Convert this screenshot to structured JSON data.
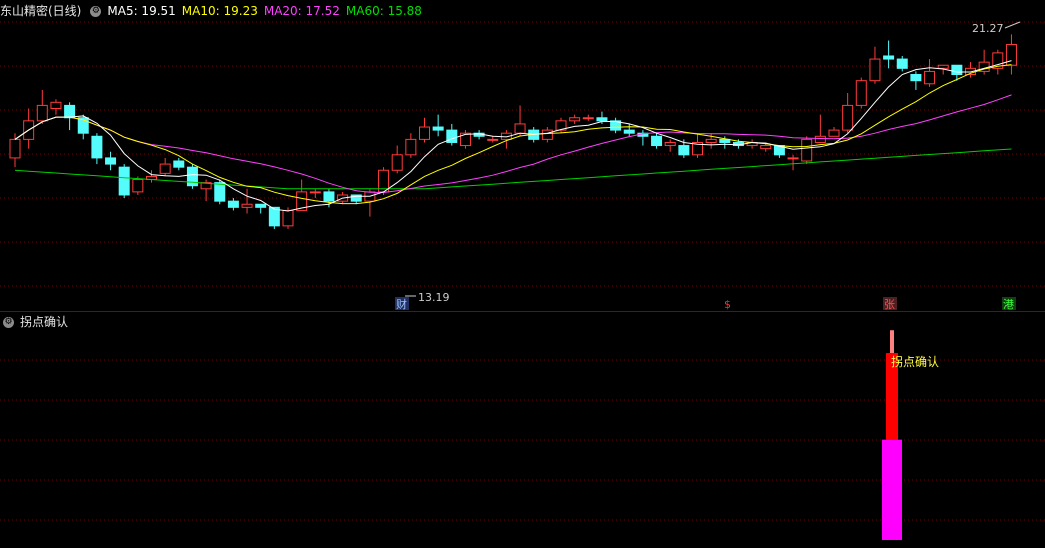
{
  "main": {
    "title": "东山精密(日线)",
    "ma5": "MA5: 19.51",
    "ma10": "MA10: 19.23",
    "ma20": "MA20: 17.52",
    "ma60": "MA60: 15.88",
    "high_label": "21.27",
    "low_label": "13.19",
    "markers": [
      {
        "label": "财",
        "color": "#a0c0ff"
      },
      {
        "label": "$",
        "color": "#ff3030"
      },
      {
        "label": "张",
        "color": "#ff5050"
      },
      {
        "label": "港",
        "color": "#40ff40"
      }
    ]
  },
  "sub": {
    "title": "拐点确认",
    "signal_label": "拐点确认"
  },
  "colors": {
    "up": "#ff3b3b",
    "down": "#54fcfc",
    "ma5": "#ffffff",
    "ma10": "#ffff00",
    "ma20": "#ff40ff",
    "ma60": "#00d000",
    "grid": "#7a0000"
  },
  "chart_data": {
    "type": "candlestick",
    "candles": [
      [
        17.6,
        18.2,
        17.3,
        18.4
      ],
      [
        18.2,
        18.8,
        17.9,
        19.2
      ],
      [
        18.8,
        19.3,
        18.7,
        19.8
      ],
      [
        19.2,
        19.4,
        19.0,
        19.5
      ],
      [
        19.3,
        18.9,
        18.5,
        19.4
      ],
      [
        18.9,
        18.4,
        18.2,
        19.0
      ],
      [
        18.3,
        17.6,
        17.4,
        18.4
      ],
      [
        17.6,
        17.4,
        17.2,
        17.8
      ],
      [
        17.3,
        16.4,
        16.3,
        17.4
      ],
      [
        16.5,
        16.9,
        16.4,
        17.0
      ],
      [
        16.9,
        17.0,
        16.8,
        17.2
      ],
      [
        17.1,
        17.4,
        17.0,
        17.6
      ],
      [
        17.5,
        17.3,
        17.2,
        17.6
      ],
      [
        17.3,
        16.7,
        16.6,
        17.4
      ],
      [
        16.6,
        16.8,
        16.2,
        16.9
      ],
      [
        16.8,
        16.2,
        16.1,
        16.9
      ],
      [
        16.2,
        16.0,
        15.9,
        16.3
      ],
      [
        16.0,
        16.1,
        15.8,
        16.6
      ],
      [
        16.1,
        16.0,
        15.8,
        16.1
      ],
      [
        16.0,
        15.4,
        15.3,
        16.0
      ],
      [
        15.4,
        15.9,
        15.3,
        16.0
      ],
      [
        15.9,
        16.5,
        15.9,
        16.9
      ],
      [
        16.5,
        16.5,
        16.3,
        16.6
      ],
      [
        16.5,
        16.2,
        16.0,
        16.6
      ],
      [
        16.2,
        16.4,
        16.1,
        16.5
      ],
      [
        16.4,
        16.2,
        16.1,
        16.4
      ],
      [
        16.2,
        16.5,
        15.7,
        16.6
      ],
      [
        16.5,
        17.2,
        16.4,
        17.3
      ],
      [
        17.2,
        17.7,
        17.1,
        18.0
      ],
      [
        17.7,
        18.2,
        17.6,
        18.4
      ],
      [
        18.2,
        18.6,
        18.1,
        18.9
      ],
      [
        18.6,
        18.5,
        18.3,
        19.0
      ],
      [
        18.5,
        18.1,
        18.0,
        18.7
      ],
      [
        18.0,
        18.4,
        17.9,
        18.5
      ],
      [
        18.4,
        18.3,
        18.2,
        18.5
      ],
      [
        18.2,
        18.2,
        18.1,
        18.3
      ],
      [
        18.2,
        18.4,
        17.9,
        18.5
      ],
      [
        18.4,
        18.7,
        18.3,
        19.3
      ],
      [
        18.5,
        18.2,
        18.1,
        18.6
      ],
      [
        18.2,
        18.5,
        18.1,
        18.6
      ],
      [
        18.5,
        18.8,
        18.4,
        18.9
      ],
      [
        18.8,
        18.9,
        18.7,
        19.0
      ],
      [
        18.9,
        18.9,
        18.8,
        19.0
      ],
      [
        18.9,
        18.8,
        18.7,
        19.1
      ],
      [
        18.8,
        18.5,
        18.4,
        18.9
      ],
      [
        18.5,
        18.4,
        18.3,
        18.7
      ],
      [
        18.4,
        18.3,
        18.0,
        18.5
      ],
      [
        18.3,
        18.0,
        17.9,
        18.4
      ],
      [
        18.0,
        18.1,
        17.8,
        18.2
      ],
      [
        18.0,
        17.7,
        17.6,
        18.2
      ],
      [
        17.7,
        18.1,
        17.6,
        18.4
      ],
      [
        18.1,
        18.2,
        17.9,
        18.4
      ],
      [
        18.2,
        18.1,
        17.9,
        18.3
      ],
      [
        18.1,
        18.0,
        17.9,
        18.2
      ],
      [
        18.0,
        18.1,
        17.9,
        18.2
      ],
      [
        17.9,
        18.0,
        17.8,
        18.1
      ],
      [
        18.0,
        17.7,
        17.6,
        18.0
      ],
      [
        17.6,
        17.6,
        17.2,
        17.7
      ],
      [
        17.5,
        18.2,
        17.4,
        18.3
      ],
      [
        18.1,
        18.3,
        18.1,
        19.0
      ],
      [
        18.3,
        18.5,
        18.3,
        18.6
      ],
      [
        18.5,
        19.3,
        18.4,
        19.7
      ],
      [
        19.3,
        20.1,
        19.2,
        20.2
      ],
      [
        20.1,
        20.8,
        20.0,
        21.2
      ],
      [
        20.9,
        20.8,
        20.5,
        21.4
      ],
      [
        20.8,
        20.5,
        20.4,
        20.9
      ],
      [
        20.3,
        20.1,
        19.8,
        20.4
      ],
      [
        20.0,
        20.4,
        19.9,
        20.8
      ],
      [
        20.5,
        20.6,
        20.3,
        20.6
      ],
      [
        20.6,
        20.3,
        20.1,
        20.6
      ],
      [
        20.3,
        20.5,
        20.2,
        20.7
      ],
      [
        20.4,
        20.7,
        20.3,
        21.1
      ],
      [
        20.5,
        21.0,
        20.3,
        21.1
      ],
      [
        20.6,
        21.27,
        20.3,
        21.6
      ]
    ],
    "ma5": [],
    "ma10": [],
    "ma20": [],
    "ma60": [],
    "signal_bars": [
      {
        "index": 63,
        "magenta": 0.44,
        "red": 0.82,
        "pink": 0.92
      }
    ]
  }
}
